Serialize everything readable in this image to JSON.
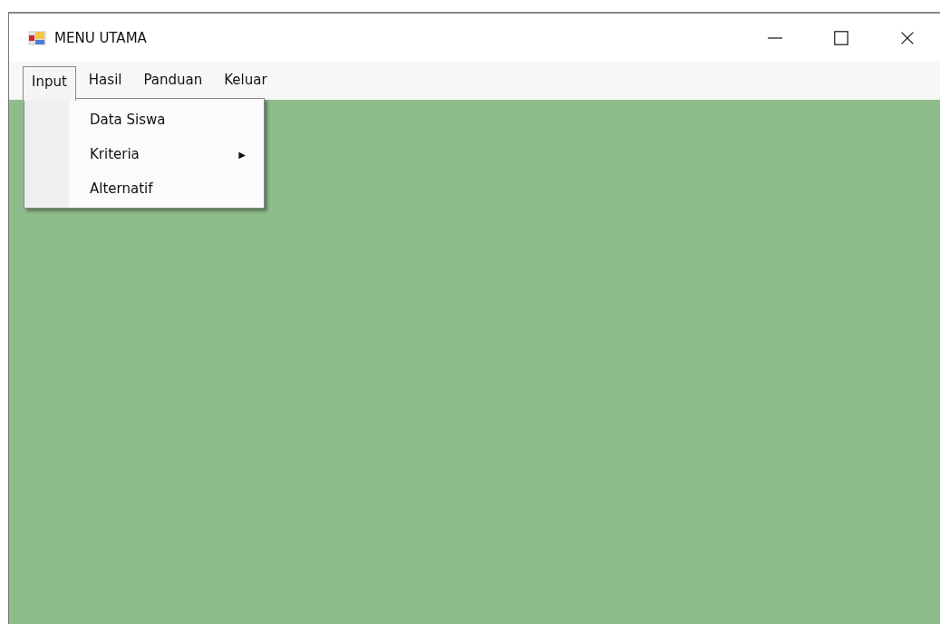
{
  "window": {
    "title": "MENU UTAMA"
  },
  "menu": [
    {
      "label": "Input",
      "selected": true
    },
    {
      "label": "Hasil",
      "selected": false
    },
    {
      "label": "Panduan",
      "selected": false
    },
    {
      "label": "Keluar",
      "selected": false
    }
  ],
  "dropdown": [
    {
      "label": "Data Siswa"
    },
    {
      "label": "Kriteria",
      "submenu_arrow": "▶"
    },
    {
      "label": "Alternatif"
    }
  ]
}
